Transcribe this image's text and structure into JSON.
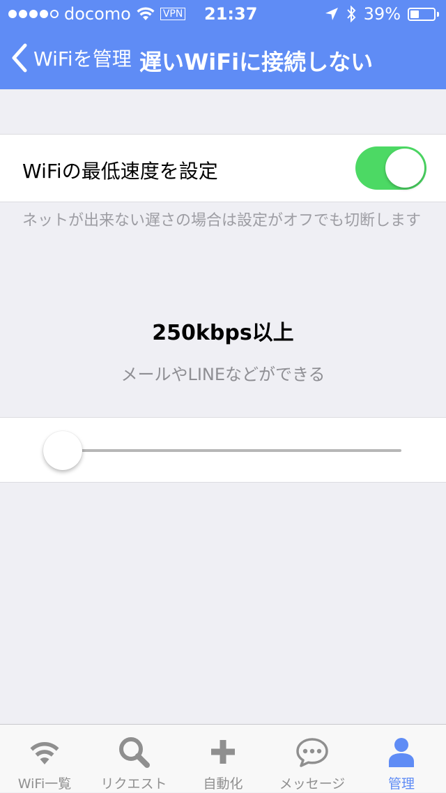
{
  "status_bar": {
    "carrier": "docomo",
    "vpn": "VPN",
    "time": "21:37",
    "battery_percent": "39%",
    "battery_level": 0.39,
    "icons": [
      "signal-dots-icon",
      "wifi-icon",
      "location-arrow-icon",
      "bluetooth-icon",
      "battery-icon"
    ]
  },
  "nav": {
    "back_label": "WiFiを管理",
    "title": "遅いWiFiに接続しない"
  },
  "settings": {
    "toggle_label": "WiFiの最低速度を設定",
    "toggle_on": true,
    "footnote": "ネットが出来ない遅さの場合は設定がオフでも切断します"
  },
  "speed": {
    "value_label": "250kbps以上",
    "description": "メールやLINEなどができる",
    "slider_position": 0.0
  },
  "tabbar": {
    "active_index": 4,
    "tabs": [
      {
        "label": "WiFi一覧",
        "icon": "wifi-icon"
      },
      {
        "label": "リクエスト",
        "icon": "search-icon"
      },
      {
        "label": "自動化",
        "icon": "plus-icon"
      },
      {
        "label": "メッセージ",
        "icon": "chat-bubble-icon"
      },
      {
        "label": "管理",
        "icon": "person-icon"
      }
    ]
  },
  "colors": {
    "accent": "#5f8cf5",
    "toggle_on": "#4cd964",
    "background": "#efeff4",
    "tab_inactive": "#8f8f8f"
  }
}
